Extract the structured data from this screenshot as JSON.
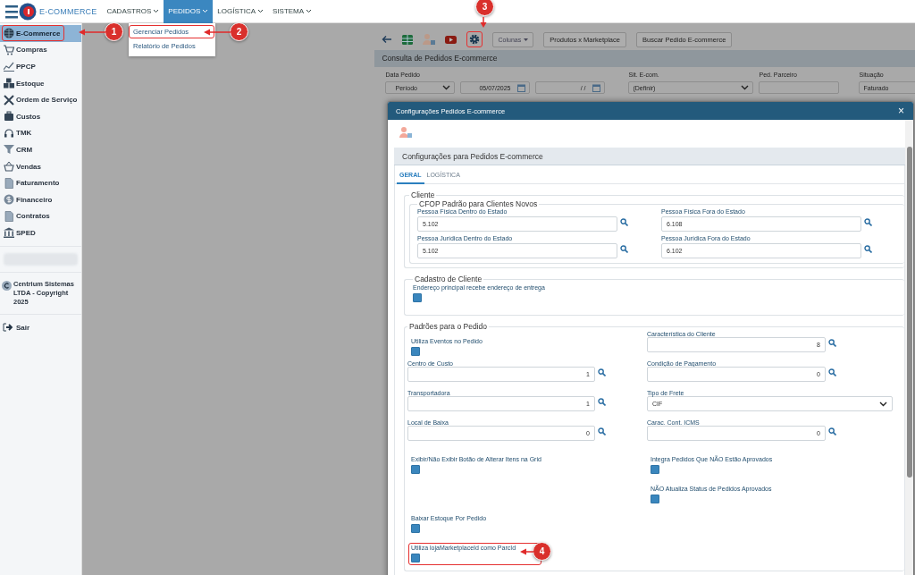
{
  "app": {
    "logo_text": "E-COMMERCE"
  },
  "menu": [
    {
      "label": "CADASTROS",
      "selected": false
    },
    {
      "label": "PEDIDOS",
      "selected": true
    },
    {
      "label": "LOGÍSTICA",
      "selected": false
    },
    {
      "label": "SISTEMA",
      "selected": false
    }
  ],
  "dropdown": [
    {
      "label": "Gerenciar Pedidos",
      "highlighted": true
    },
    {
      "label": "Relatório de Pedidos",
      "highlighted": false
    }
  ],
  "sidebar": {
    "items": [
      {
        "label": "E-Commerce",
        "selected": true,
        "highlighted": true
      },
      {
        "label": "Compras",
        "selected": false,
        "highlighted": false
      },
      {
        "label": "PPCP",
        "selected": false,
        "highlighted": false
      },
      {
        "label": "Estoque",
        "selected": false,
        "highlighted": false
      },
      {
        "label": "Ordem de Serviço",
        "selected": false,
        "highlighted": false
      },
      {
        "label": "Custos",
        "selected": false,
        "highlighted": false
      },
      {
        "label": "TMK",
        "selected": false,
        "highlighted": false
      },
      {
        "label": "CRM",
        "selected": false,
        "highlighted": false
      },
      {
        "label": "Vendas",
        "selected": false,
        "highlighted": false
      },
      {
        "label": "Faturamento",
        "selected": false,
        "highlighted": false
      },
      {
        "label": "Financeiro",
        "selected": false,
        "highlighted": false
      },
      {
        "label": "Contratos",
        "selected": false,
        "highlighted": false
      },
      {
        "label": "SPED",
        "selected": false,
        "highlighted": false
      }
    ],
    "copyright": "Centrium Sistemas LTDA - Copyright 2025",
    "logout": "Sair"
  },
  "toolbar": {
    "settings_highlighted": true,
    "columns_button": "Colunas",
    "buttons": [
      "Produtos x Marketplace",
      "Buscar Pedido E-commerce"
    ]
  },
  "panel": {
    "title": "Consulta de Pedidos E-commerce",
    "filters": [
      {
        "label": "Data Pedido",
        "kind": "select",
        "value": "Período"
      },
      {
        "kind": "date",
        "value": "05/07/2025"
      },
      {
        "kind": "date",
        "value": "/ /"
      },
      {
        "label": "Sit. E-com.",
        "kind": "select",
        "value": "(Definir)"
      },
      {
        "label": "Ped. Parceiro",
        "kind": "text"
      },
      {
        "label": "Situação",
        "kind": "text",
        "value": "Faturado"
      }
    ]
  },
  "modal": {
    "title": "Configurações Pedidos E-commerce",
    "close": "×",
    "section_title": "Configurações para Pedidos E-commerce",
    "tabs": [
      {
        "label": "GERAL",
        "selected": true
      },
      {
        "label": "LOGÍSTICA",
        "selected": false
      }
    ],
    "cliente": {
      "legend": "Cliente",
      "cfop_legend": "CFOP Padrão para Clientes Novos",
      "fields": [
        {
          "label": "Pessoa Física Dentro do Estado",
          "value": "5.102"
        },
        {
          "label": "Pessoa Física Fora do Estado",
          "value": "6.108"
        },
        {
          "label": "Pessoa Jurídica Dentro do Estado",
          "value": "5.102"
        },
        {
          "label": "Pessoa Jurídica Fora do Estado",
          "value": "6.102"
        }
      ]
    },
    "cadastro": {
      "legend": "Cadastro de Cliente",
      "label": "Endereço principal recebe endereço de entrega",
      "checked": false
    },
    "padroes": {
      "legend": "Padrões para o Pedido",
      "rows": [
        {
          "left": {
            "kind": "checkbox",
            "label": "Utiliza Eventos no Pedido",
            "checked": false
          },
          "right": {
            "kind": "lookup",
            "label": "Característica do Cliente",
            "value": "8"
          }
        },
        {
          "left": {
            "kind": "lookup",
            "label": "Centro de Custo",
            "value": "1"
          },
          "right": {
            "kind": "lookup",
            "label": "Condição de Pagamento",
            "value": "0"
          }
        },
        {
          "left": {
            "kind": "lookup",
            "label": "Transportadora",
            "value": "1"
          },
          "right": {
            "kind": "select",
            "label": "Tipo de Frete",
            "value": "CIF"
          }
        },
        {
          "left": {
            "kind": "lookup",
            "label": "Local de Baixa",
            "value": "0"
          },
          "right": {
            "kind": "lookup",
            "label": "Carac. Cont. ICMS",
            "value": "0"
          }
        },
        {
          "left": {
            "kind": "checkbox",
            "label": "Exibir/Não Exibir Botão de Alterar Itens na Grid",
            "checked": false
          },
          "right": {
            "kind": "checkbox",
            "label": "Integra Pedidos Que NÃO Estão Aprovados",
            "checked": false
          }
        },
        {
          "right": {
            "kind": "checkbox",
            "label": "NÃO Atualiza Status de Pedidos Aprovados",
            "checked": false
          }
        },
        {
          "left": {
            "kind": "checkbox",
            "label": "Baixar Estoque Por Pedido",
            "checked": false
          }
        },
        {
          "left": {
            "kind": "checkbox",
            "label": "Utiliza lojaMarketplaceId como ParcId",
            "checked": false,
            "highlighted": true
          }
        }
      ]
    }
  },
  "callouts": [
    "1",
    "2",
    "3",
    "4"
  ]
}
